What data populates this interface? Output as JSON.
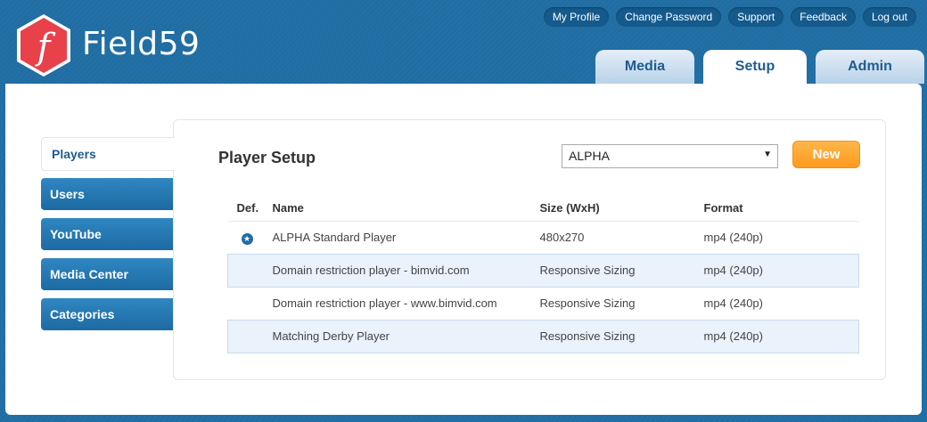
{
  "brand": {
    "name": "Field59",
    "logo_letter": "f",
    "accent": "#e8414a"
  },
  "top_links": [
    "My Profile",
    "Change Password",
    "Support",
    "Feedback",
    "Log out"
  ],
  "tabs": [
    {
      "label": "Media",
      "active": false
    },
    {
      "label": "Setup",
      "active": true
    },
    {
      "label": "Admin",
      "active": false
    }
  ],
  "sidebar": {
    "items": [
      {
        "label": "Players",
        "active": true
      },
      {
        "label": "Users",
        "active": false
      },
      {
        "label": "YouTube",
        "active": false
      },
      {
        "label": "Media Center",
        "active": false
      },
      {
        "label": "Categories",
        "active": false
      }
    ]
  },
  "content": {
    "title": "Player Setup",
    "select_value": "ALPHA",
    "new_label": "New",
    "columns": [
      "Def.",
      "Name",
      "Size (WxH)",
      "Format"
    ],
    "rows": [
      {
        "default": true,
        "default_icon": "star-icon",
        "name": "ALPHA Standard Player",
        "size": "480x270",
        "format": "mp4 (240p)"
      },
      {
        "default": false,
        "name": "Domain restriction player - bimvid.com",
        "size": "Responsive Sizing",
        "format": "mp4 (240p)"
      },
      {
        "default": false,
        "name": "Domain restriction player - www.bimvid.com",
        "size": "Responsive Sizing",
        "format": "mp4 (240p)"
      },
      {
        "default": false,
        "name": "Matching Derby Player",
        "size": "Responsive Sizing",
        "format": "mp4 (240p)"
      }
    ]
  }
}
